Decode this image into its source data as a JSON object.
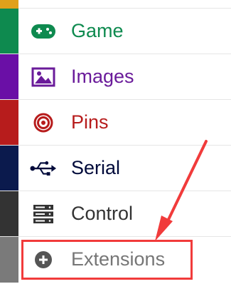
{
  "toolbox": {
    "top_stripe_color": "#e0a11b",
    "categories": [
      {
        "id": "game",
        "label": "Game",
        "icon": "gamepad-icon",
        "color": "#0e8a4f",
        "stripe": "#0e8a4f"
      },
      {
        "id": "images",
        "label": "Images",
        "icon": "image-icon",
        "color": "#6a1b9a",
        "stripe": "#6a0fa6"
      },
      {
        "id": "pins",
        "label": "Pins",
        "icon": "target-icon",
        "color": "#b71c1c",
        "stripe": "#b71c1c"
      },
      {
        "id": "serial",
        "label": "Serial",
        "icon": "usb-icon",
        "color": "#000a3a",
        "stripe": "#0b1a4d"
      },
      {
        "id": "control",
        "label": "Control",
        "icon": "server-icon",
        "color": "#333333",
        "stripe": "#333333"
      },
      {
        "id": "extensions",
        "label": "Extensions",
        "icon": "plus-circle-icon",
        "color": "#767676",
        "stripe": "#7a7a7a"
      }
    ]
  },
  "annotation": {
    "color": "#f13b3b",
    "highlight_target": "extensions"
  }
}
